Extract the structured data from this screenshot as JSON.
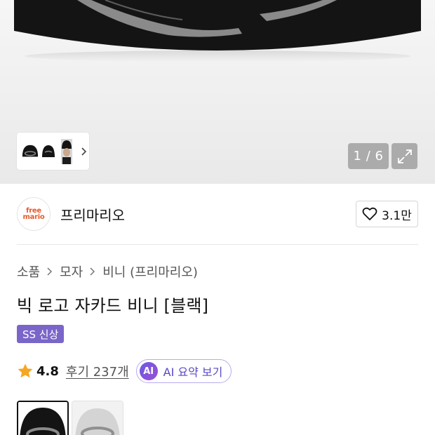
{
  "gallery": {
    "counter": "1 / 6",
    "thumbnails": [
      "beanie-black-thumb",
      "beanie-black-side-thumb",
      "model-wearing-thumb"
    ],
    "colors": {
      "knit_black": "#141414",
      "logo_gray": "#8a8a8a",
      "background": "#efefef"
    }
  },
  "brand": {
    "logo_line1": "free",
    "logo_line2": "mario",
    "name": "프리마리오",
    "like_count": "3.1만"
  },
  "breadcrumb": {
    "items": [
      "소품",
      "모자",
      "비니 (프리마리오)"
    ]
  },
  "product": {
    "title": "빅 로고 자카드 비니 [블랙]",
    "badge": "SS 신상",
    "rating": "4.8",
    "reviews": "후기 237개",
    "ai_badge": "AI",
    "ai_summary": "AI 요약 보기"
  },
  "options": {
    "swatches": [
      "black",
      "gray"
    ]
  },
  "colors": {
    "accent_purple": "#7a66c9",
    "star": "#f5a623",
    "brand_orange": "#e65a2a"
  }
}
